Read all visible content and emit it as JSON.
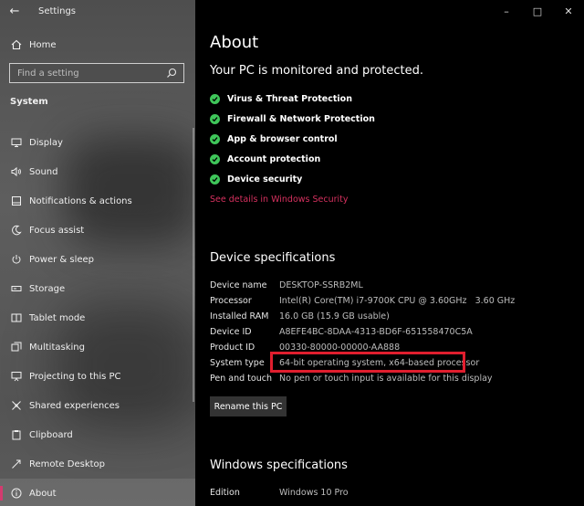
{
  "window": {
    "title": "Settings",
    "controls": [
      "minimize",
      "maximize",
      "close"
    ]
  },
  "sidebar": {
    "home_label": "Home",
    "search_placeholder": "Find a setting",
    "section": "System",
    "items": [
      {
        "label": "Display",
        "icon": "display-icon"
      },
      {
        "label": "Sound",
        "icon": "sound-icon"
      },
      {
        "label": "Notifications & actions",
        "icon": "notifications-icon"
      },
      {
        "label": "Focus assist",
        "icon": "focus-assist-icon"
      },
      {
        "label": "Power & sleep",
        "icon": "power-icon"
      },
      {
        "label": "Storage",
        "icon": "storage-icon"
      },
      {
        "label": "Tablet mode",
        "icon": "tablet-mode-icon"
      },
      {
        "label": "Multitasking",
        "icon": "multitasking-icon"
      },
      {
        "label": "Projecting to this PC",
        "icon": "projecting-icon"
      },
      {
        "label": "Shared experiences",
        "icon": "shared-experiences-icon"
      },
      {
        "label": "Clipboard",
        "icon": "clipboard-icon"
      },
      {
        "label": "Remote Desktop",
        "icon": "remote-desktop-icon"
      },
      {
        "label": "About",
        "icon": "info-icon",
        "active": true
      }
    ]
  },
  "main": {
    "title": "About",
    "protection_heading": "Your PC is monitored and protected.",
    "protection_items": [
      "Virus & Threat Protection",
      "Firewall & Network Protection",
      "App & browser control",
      "Account protection",
      "Device security"
    ],
    "security_link": "See details in Windows Security",
    "device_specs_heading": "Device specifications",
    "device_specs": [
      {
        "key": "Device name",
        "value": "DESKTOP-SSRB2ML"
      },
      {
        "key": "Processor",
        "value": "Intel(R) Core(TM) i7-9700K CPU @ 3.60GHz   3.60 GHz"
      },
      {
        "key": "Installed RAM",
        "value": "16.0 GB (15.9 GB usable)"
      },
      {
        "key": "Device ID",
        "value": "A8EFE4BC-8DAA-4313-BD6F-651558470C5A"
      },
      {
        "key": "Product ID",
        "value": "00330-80000-00000-AA888"
      },
      {
        "key": "System type",
        "value": "64-bit operating system, x64-based processor"
      },
      {
        "key": "Pen and touch",
        "value": "No pen or touch input is available for this display"
      }
    ],
    "rename_button": "Rename this PC",
    "windows_specs_heading": "Windows specifications",
    "windows_specs": [
      {
        "key": "Edition",
        "value": "Windows 10 Pro"
      }
    ]
  },
  "colors": {
    "accent_pink": "#d6315f",
    "check_green": "#3fc65a",
    "highlight_red": "#e01e2e"
  }
}
